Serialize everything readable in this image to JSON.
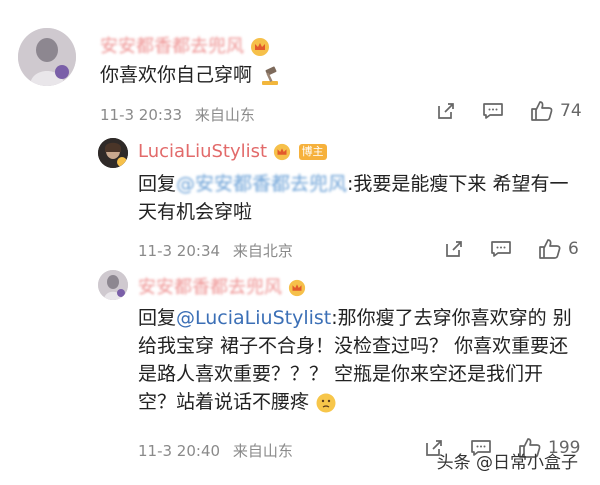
{
  "comment1": {
    "username": "安安都香都去兜风",
    "text": "你喜欢你自己穿啊",
    "time": "11-3 20:33",
    "location": "来自山东",
    "likes": "74"
  },
  "reply1": {
    "username": "LuciaLiuStylist",
    "badge": "博主",
    "reply_prefix": "回复",
    "mention": "@安安都香都去兜风",
    "text": ":我要是能瘦下来 希望有一天有机会穿啦",
    "time": "11-3 20:34",
    "location": "来自北京",
    "likes": "6"
  },
  "reply2": {
    "username": "安安都香都去兜风",
    "reply_prefix": "回复",
    "mention": "@LuciaLiuStylist",
    "text": ":那你瘦了去穿你喜欢穿的 别给我宝穿 裙子不合身！没检查过吗？ 你喜欢重要还是路人喜欢重要？？？ 空瓶是你来空还是我们开空？站着说话不腰疼",
    "time": "11-3 20:40",
    "location": "来自山东",
    "likes": "199"
  },
  "watermark": {
    "label": "头条 @日常小盒子"
  },
  "icons": {
    "share": "share-icon",
    "comment": "comment-icon",
    "like": "thumbs-up-icon"
  }
}
